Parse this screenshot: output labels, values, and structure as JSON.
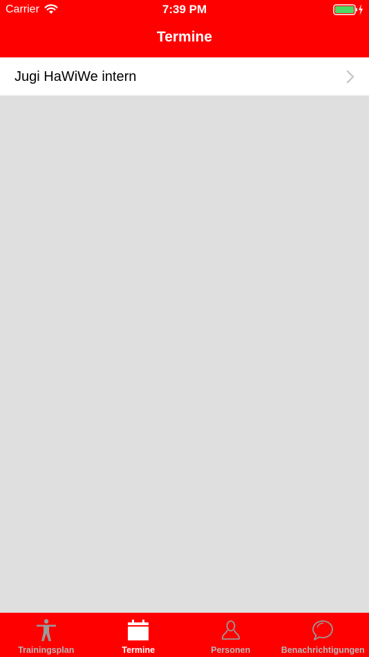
{
  "status_bar": {
    "carrier": "Carrier",
    "time": "7:39 PM"
  },
  "nav": {
    "title": "Termine"
  },
  "list": {
    "items": [
      {
        "label": "Jugi HaWiWe intern"
      }
    ]
  },
  "tabbar": {
    "active_index": 1,
    "tabs": [
      {
        "label": "Trainingsplan",
        "icon": "person-figure-icon"
      },
      {
        "label": "Termine",
        "icon": "calendar-icon"
      },
      {
        "label": "Personen",
        "icon": "person-icon"
      },
      {
        "label": "Benachrichtigungen",
        "icon": "chat-bubbles-icon"
      }
    ]
  },
  "colors": {
    "brand": "#ff0000",
    "background": "#dfdfdf",
    "inactive_tab": "#b8b8b8",
    "active_tab": "#ffffff",
    "battery_fill": "#4cd964"
  }
}
